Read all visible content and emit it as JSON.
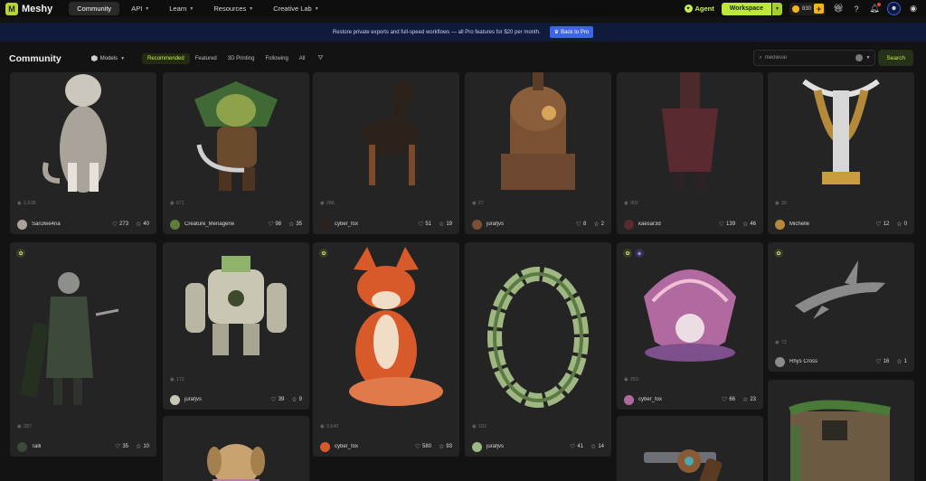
{
  "nav": {
    "logo_text": "Meshy",
    "links": [
      {
        "label": "Community",
        "active": true,
        "has_caret": false
      },
      {
        "label": "API",
        "active": false,
        "has_caret": true
      },
      {
        "label": "Learn",
        "active": false,
        "has_caret": true
      },
      {
        "label": "Resources",
        "active": false,
        "has_caret": true
      },
      {
        "label": "Creative Lab",
        "active": false,
        "has_caret": true
      }
    ],
    "agent_label": "Agent",
    "workspace_label": "Workspace",
    "credits": "830"
  },
  "promo": {
    "text": "Restore private exports and full-speed workflows — all Pro features for $20 per month.",
    "button_label": "Back to Pro"
  },
  "toolbar": {
    "title": "Community",
    "models_label": "Models",
    "filters": [
      "Recommended",
      "Featured",
      "3D Printing",
      "Following",
      "All"
    ],
    "active_filter": "Recommended",
    "search_value": "medieval",
    "search_button": "Search"
  },
  "cards": [
    {
      "user": "San3we4ria",
      "likes": "273",
      "stars": "40",
      "views": "1,638",
      "subject": "cat",
      "color": "#a9a39a"
    },
    {
      "user": "Creature_Menagerie",
      "likes": "98",
      "stars": "35",
      "views": "671",
      "subject": "goblin",
      "color": "#5f7d3a"
    },
    {
      "user": "cyber_fox",
      "likes": "51",
      "stars": "19",
      "views": "286",
      "subject": "dog",
      "color": "#2a211b"
    },
    {
      "user": "jurafjvs",
      "likes": "8",
      "stars": "2",
      "views": "27",
      "subject": "tower",
      "color": "#7a5233"
    },
    {
      "user": "kaesar3d",
      "likes": "139",
      "stars": "46",
      "views": "902",
      "subject": "knight-red",
      "color": "#5a2a30"
    },
    {
      "user": "Michelle",
      "likes": "12",
      "stars": "0",
      "views": "30",
      "subject": "trophy",
      "color": "#b48a3a"
    },
    {
      "user": "Talli",
      "likes": "35",
      "stars": "10",
      "views": "287",
      "subject": "warrior",
      "color": "#3d4a3a"
    },
    {
      "user": "jurafjvs",
      "likes": "39",
      "stars": "9",
      "views": "172",
      "subject": "mech",
      "color": "#c9c7b4"
    },
    {
      "user": "cyber_fox",
      "likes": "580",
      "stars": "93",
      "views": "3,642",
      "subject": "fox",
      "color": "#d85a2b"
    },
    {
      "user": "jurafjvs",
      "likes": "41",
      "stars": "14",
      "views": "162",
      "subject": "ring",
      "color": "#9fb883"
    },
    {
      "user": "cyber_fox",
      "likes": "66",
      "stars": "23",
      "views": "253",
      "subject": "shell",
      "color": "#b06aa0"
    },
    {
      "user": "Rhys Cross",
      "likes": "16",
      "stars": "1",
      "views": "72",
      "subject": "dolphin",
      "color": "#8a8a8a"
    },
    {
      "user": "",
      "likes": "",
      "stars": "",
      "views": "",
      "subject": "dog2",
      "color": "#c8a271"
    },
    {
      "user": "",
      "likes": "",
      "stars": "",
      "views": "",
      "subject": "gun",
      "color": "#6e7078"
    },
    {
      "user": "",
      "likes": "",
      "stars": "",
      "views": "",
      "subject": "house",
      "color": "#6d5a42"
    }
  ]
}
